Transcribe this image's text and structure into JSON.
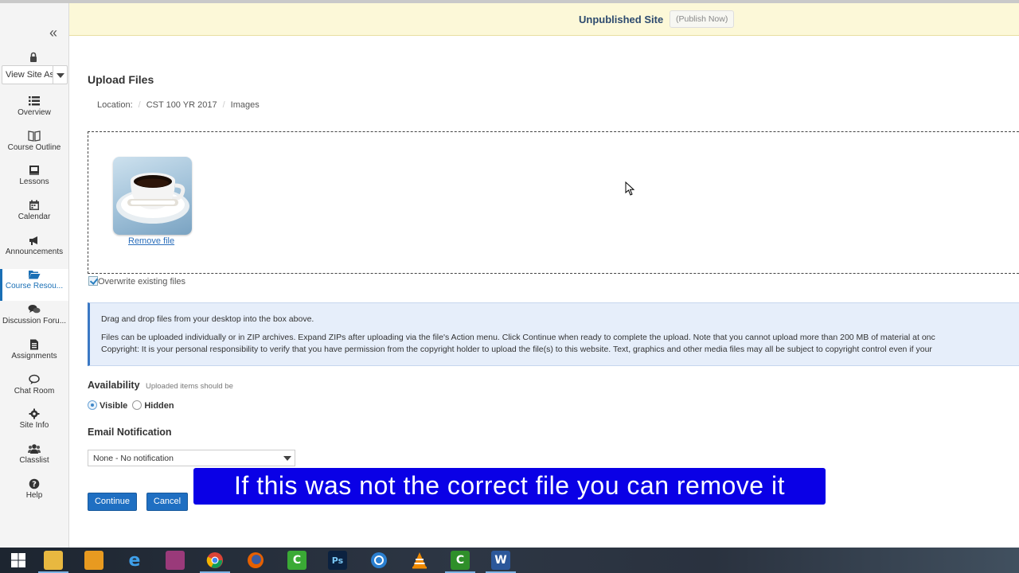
{
  "banner": {
    "site_status": "Unpublished Site",
    "publish_button": "(Publish Now)"
  },
  "sidebar": {
    "view_site_as": "View Site As",
    "items": [
      {
        "label": "Overview",
        "icon": "list-icon"
      },
      {
        "label": "Course Outline",
        "icon": "book-icon"
      },
      {
        "label": "Lessons",
        "icon": "open-book-icon"
      },
      {
        "label": "Calendar",
        "icon": "calendar-icon"
      },
      {
        "label": "Announcements",
        "icon": "megaphone-icon"
      },
      {
        "label": "Course Resou...",
        "icon": "folder-open-icon",
        "active": true
      },
      {
        "label": "Discussion Foru...",
        "icon": "comments-icon"
      },
      {
        "label": "Assignments",
        "icon": "file-icon"
      },
      {
        "label": "Chat Room",
        "icon": "chat-icon"
      },
      {
        "label": "Site Info",
        "icon": "gear-icon"
      },
      {
        "label": "Classlist",
        "icon": "users-icon"
      },
      {
        "label": "Help",
        "icon": "help-icon"
      }
    ]
  },
  "main": {
    "title": "Upload Files",
    "breadcrumb": {
      "label": "Location:",
      "parts": [
        "CST 100 YR 2017",
        "Images"
      ]
    },
    "dropzone": {
      "remove_link": "Remove file"
    },
    "overwrite_label": "Overwrite existing files",
    "overwrite_checked": true,
    "info": {
      "line1": "Drag and drop files from your desktop into the box above.",
      "line2": "Files can be uploaded individually or in ZIP archives. Expand ZIPs after uploading via the file's Action menu. Click Continue when ready to complete the upload. Note that you cannot upload more than 200 MB of material at onc",
      "line3": "Copyright: It is your personal responsibility to verify that you have permission from the copyright holder to upload the file(s) to this website. Text, graphics and other media files may all be subject to copyright control even if your"
    },
    "availability": {
      "heading": "Availability",
      "subtext": "Uploaded items should be",
      "options": [
        "Visible",
        "Hidden"
      ],
      "selected": "Visible"
    },
    "email_notification": {
      "heading": "Email Notification",
      "selected": "None - No notification"
    },
    "buttons": {
      "continue": "Continue",
      "cancel": "Cancel"
    }
  },
  "caption": "If this was not the correct file you can remove it",
  "taskbar": {
    "apps": [
      "windows-start",
      "file-explorer",
      "notes-app",
      "internet-explorer",
      "archive-app",
      "chrome",
      "firefox",
      "camtasia",
      "photoshop",
      "network-app",
      "vlc",
      "camtasia-recorder",
      "word"
    ],
    "colors": {
      "accent": "#1f6fc2",
      "caption_bg": "#0a00e6",
      "banner_bg": "#fcf8d8"
    }
  }
}
